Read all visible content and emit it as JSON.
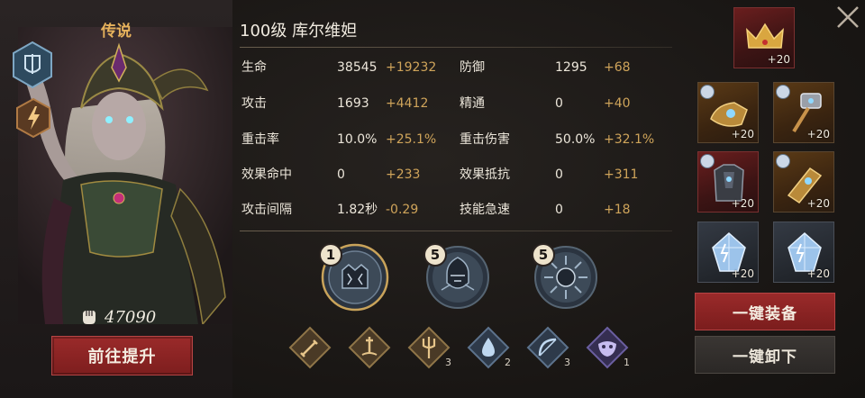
{
  "hero": {
    "rarity": "传说",
    "power": "47090",
    "upgrade_label": "前往提升",
    "class_icon": "shield-sword-icon",
    "element_icon": "lightning-icon"
  },
  "title": "100级 库尔维妲",
  "stats": [
    {
      "label": "生命",
      "value": "38545",
      "bonus": "+19232"
    },
    {
      "label": "防御",
      "value": "1295",
      "bonus": "+68"
    },
    {
      "label": "攻击",
      "value": "1693",
      "bonus": "+4412"
    },
    {
      "label": "精通",
      "value": "0",
      "bonus": "+40"
    },
    {
      "label": "重击率",
      "value": "10.0%",
      "bonus": "+25.1%"
    },
    {
      "label": "重击伤害",
      "value": "50.0%",
      "bonus": "+32.1%"
    },
    {
      "label": "效果命中",
      "value": "0",
      "bonus": "+233"
    },
    {
      "label": "效果抵抗",
      "value": "0",
      "bonus": "+311"
    },
    {
      "label": "攻击间隔",
      "value": "1.82秒",
      "bonus": "-0.29"
    },
    {
      "label": "技能急速",
      "value": "0",
      "bonus": "+18"
    }
  ],
  "medallions": [
    {
      "level": "1",
      "icon": "ruin-medallion-icon"
    },
    {
      "level": "5",
      "icon": "knight-medallion-icon"
    },
    {
      "level": "5",
      "icon": "shatter-medallion-icon"
    }
  ],
  "skills": [
    {
      "icon": "sword-icon",
      "count": ""
    },
    {
      "icon": "sword-in-stone-icon",
      "count": ""
    },
    {
      "icon": "trident-icon",
      "count": "3"
    },
    {
      "icon": "water-drop-icon",
      "count": "2"
    },
    {
      "icon": "bow-icon",
      "count": "3"
    },
    {
      "icon": "mask-icon",
      "count": "1"
    }
  ],
  "equipment": [
    {
      "slot": "crown",
      "level": "+20",
      "icon": "crown-icon"
    },
    {
      "slot": "gauntlet",
      "level": "+20",
      "icon": "gauntlet-icon"
    },
    {
      "slot": "hammer",
      "level": "+20",
      "icon": "hammer-icon"
    },
    {
      "slot": "armor",
      "level": "+20",
      "icon": "armor-icon"
    },
    {
      "slot": "bracer",
      "level": "+20",
      "icon": "bracer-icon"
    },
    {
      "slot": "gem-1",
      "level": "+20",
      "icon": "crystal-icon"
    },
    {
      "slot": "gem-2",
      "level": "+20",
      "icon": "crystal-icon"
    }
  ],
  "buttons": {
    "equip_all": "一键装备",
    "unequip_all": "一键卸下"
  },
  "colors": {
    "accent_red": "#8c2424",
    "bonus_gold": "#cfa45a",
    "rarity_gold": "#e6b25c"
  }
}
